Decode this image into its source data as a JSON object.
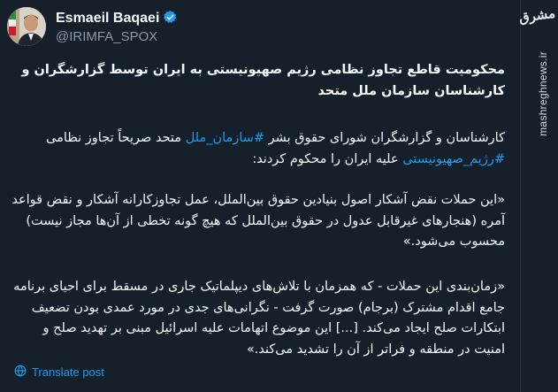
{
  "author": {
    "name": "Esmaeil Baqaei",
    "handle": "@IRIMFA_SPOX"
  },
  "watermark": {
    "logo": "مشرق",
    "url": "mashreghnews.ir"
  },
  "tweet": {
    "headline": "محکومیت قاطع تجاوز نظامی رژیم صهیونیستی به ایران توسط گزارشگران و کارشناسان سازمان ملل متحد",
    "p1_before": "کارشناسان و گزارشگران شورای حقوق بشر ",
    "p1_hashtag1": "#سازمان_ملل",
    "p1_middle": " متحد صریحاً تجاوز نظامی ",
    "p1_hashtag2": "#رژیم_صهیونیستی",
    "p1_after": " علیه ایران را محکوم کردند:",
    "p2": "«این حملات نقض آشکار اصول بنیادین حقوق بین‌الملل، عمل تجاوزکارانه آشکار و نقض قواعد آمره (هنجارهای غیرقابل عدول در حقوق بین‌الملل که هیچ گونه تخطی از آن‌ها مجاز نیست) محسوب می‌شود.»",
    "p3": "«زمان‌بندی این حملات - که همزمان با تلاش‌های دیپلماتیک جاری در مسقط برای احیای برنامه جامع اقدام مشترک (برجام) صورت گرفت - نگرانی‌های جدی در مورد عمدی بودن تضعیف ابتکارات صلح ایجاد می‌کند. [...] این موضوع اتهامات علیه اسرائیل مبنی بر تهدید صلح و امنیت در منطقه و فراتر از آن را تشدید می‌کند.»",
    "translate_label": "Translate post"
  },
  "colors": {
    "background": "#15202b",
    "text": "#f7f9f9",
    "muted": "#8b98a5",
    "link": "#1d9bf0"
  }
}
